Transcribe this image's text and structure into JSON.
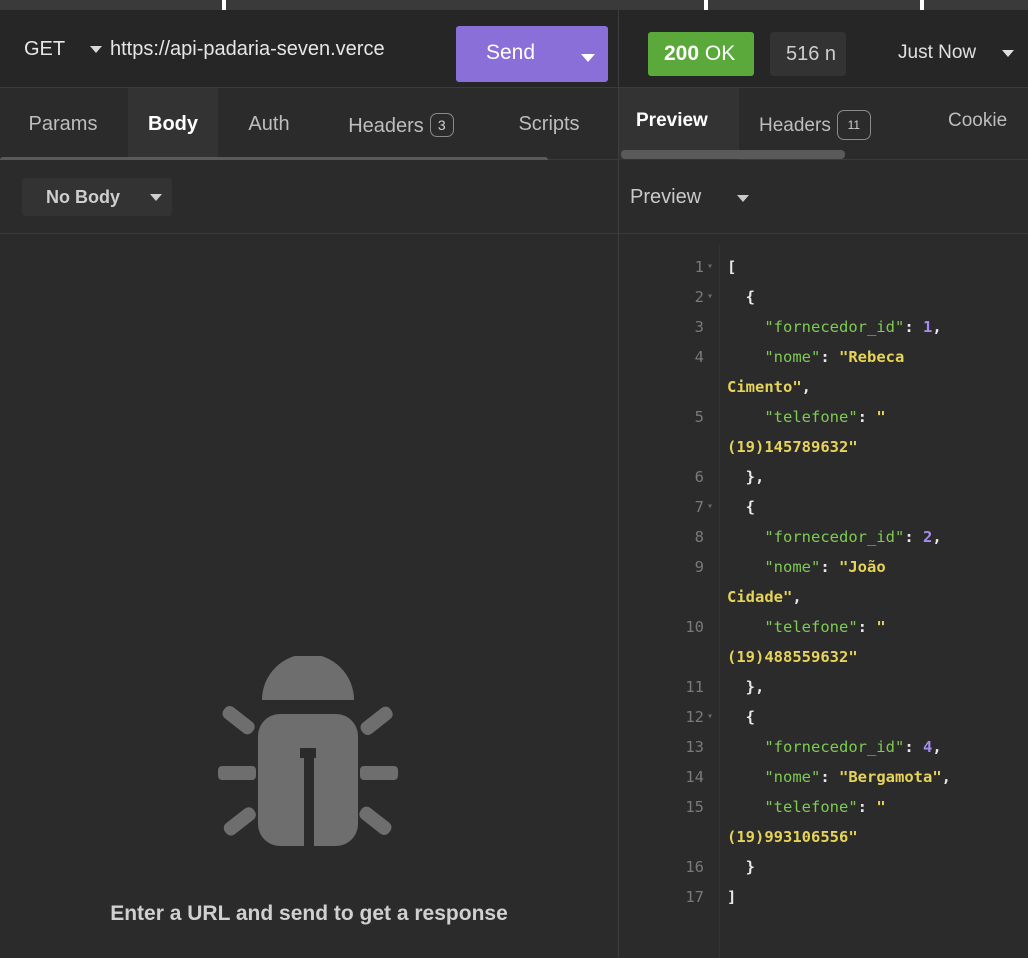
{
  "request": {
    "method": "GET",
    "url": "https://api-padaria-seven.verce",
    "send_label": "Send",
    "tabs": [
      {
        "label": "Params"
      },
      {
        "label": "Body"
      },
      {
        "label": "Auth"
      },
      {
        "label": "Headers",
        "badge": "3"
      },
      {
        "label": "Scripts"
      }
    ],
    "body_type": "No Body",
    "empty_message": "Enter a URL and send to get a response"
  },
  "response": {
    "status_code": "200",
    "status_text": "OK",
    "size": "516 n",
    "time": "Just Now",
    "tabs": [
      {
        "label": "Preview"
      },
      {
        "label": "Headers",
        "badge": "11"
      },
      {
        "label": "Cookie"
      }
    ],
    "preview_mode": "Preview",
    "lines": [
      {
        "n": "1",
        "fold": true
      },
      {
        "n": "2",
        "fold": true
      },
      {
        "n": "3"
      },
      {
        "n": "4"
      },
      {
        "n": ""
      },
      {
        "n": "5"
      },
      {
        "n": ""
      },
      {
        "n": "6"
      },
      {
        "n": "7",
        "fold": true
      },
      {
        "n": "8"
      },
      {
        "n": "9"
      },
      {
        "n": ""
      },
      {
        "n": "10"
      },
      {
        "n": ""
      },
      {
        "n": "11"
      },
      {
        "n": "12",
        "fold": true
      },
      {
        "n": "13"
      },
      {
        "n": "14"
      },
      {
        "n": "15"
      },
      {
        "n": ""
      },
      {
        "n": "16"
      },
      {
        "n": "17"
      }
    ],
    "json": {
      "open_bracket": "[",
      "close_bracket": "]",
      "open_brace": "{",
      "close_brace_comma": "},",
      "close_brace": "}",
      "key_id": "\"fornecedor_id\"",
      "key_nome": "\"nome\"",
      "key_tel": "\"telefone\"",
      "colon": ": ",
      "r1_id": "1",
      "r1_nome_a": "\"Rebeca",
      "r1_nome_b": "Cimento\"",
      "r1_tel_a": "\"",
      "r1_tel_b": "(19)145789632\"",
      "r2_id": "2",
      "r2_nome_a": "\"João",
      "r2_nome_b": "Cidade\"",
      "r2_tel_a": "\"",
      "r2_tel_b": "(19)488559632\"",
      "r3_id": "4",
      "r3_nome": "\"Bergamota\"",
      "r3_tel_a": "\"",
      "r3_tel_b": "(19)993106556\"",
      "comma": ","
    }
  },
  "icons": {
    "empty_state": "bug-icon",
    "dropdown": "caret-down-icon"
  },
  "colors": {
    "send_button": "#8b6fd8",
    "status_ok": "#5aa93a",
    "json_key": "#7ecb51",
    "json_string": "#e6d35a",
    "json_number": "#a48cf0"
  }
}
